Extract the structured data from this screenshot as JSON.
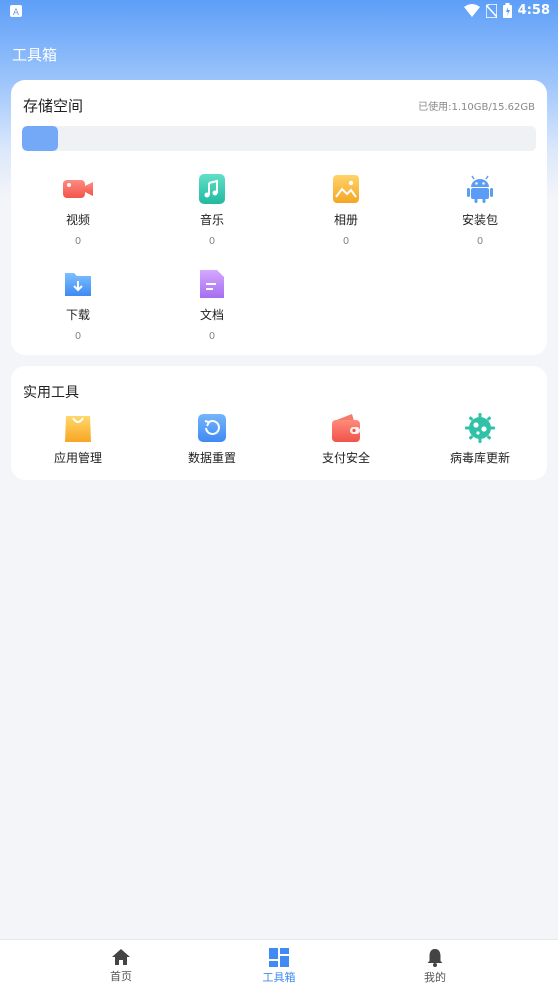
{
  "status_bar": {
    "time": "4:58"
  },
  "header": {
    "title": "工具箱"
  },
  "storage": {
    "title": "存储空间",
    "usage_text": "已使用:1.10GB/15.62GB",
    "used_fraction": 0.0704,
    "items": [
      {
        "label": "视频",
        "count": "0",
        "icon": "video-icon"
      },
      {
        "label": "音乐",
        "count": "0",
        "icon": "music-icon"
      },
      {
        "label": "相册",
        "count": "0",
        "icon": "photo-album-icon"
      },
      {
        "label": "安装包",
        "count": "0",
        "icon": "android-icon"
      },
      {
        "label": "下载",
        "count": "0",
        "icon": "download-folder-icon"
      },
      {
        "label": "文档",
        "count": "0",
        "icon": "document-icon"
      }
    ]
  },
  "tools": {
    "title": "实用工具",
    "items": [
      {
        "label": "应用管理",
        "icon": "shopping-bag-icon"
      },
      {
        "label": "数据重置",
        "icon": "reset-icon"
      },
      {
        "label": "支付安全",
        "icon": "wallet-icon"
      },
      {
        "label": "病毒库更新",
        "icon": "virus-icon"
      }
    ]
  },
  "bottom_nav": {
    "items": [
      {
        "label": "首页",
        "icon": "home-icon"
      },
      {
        "label": "工具箱",
        "icon": "toolbox-grid-icon",
        "active": true
      },
      {
        "label": "我的",
        "icon": "bell-icon"
      }
    ]
  },
  "colors": {
    "accent": "#3f8af4",
    "header_gradient_top": "#5d9ef8",
    "bar_fill": "#74a9f8"
  }
}
